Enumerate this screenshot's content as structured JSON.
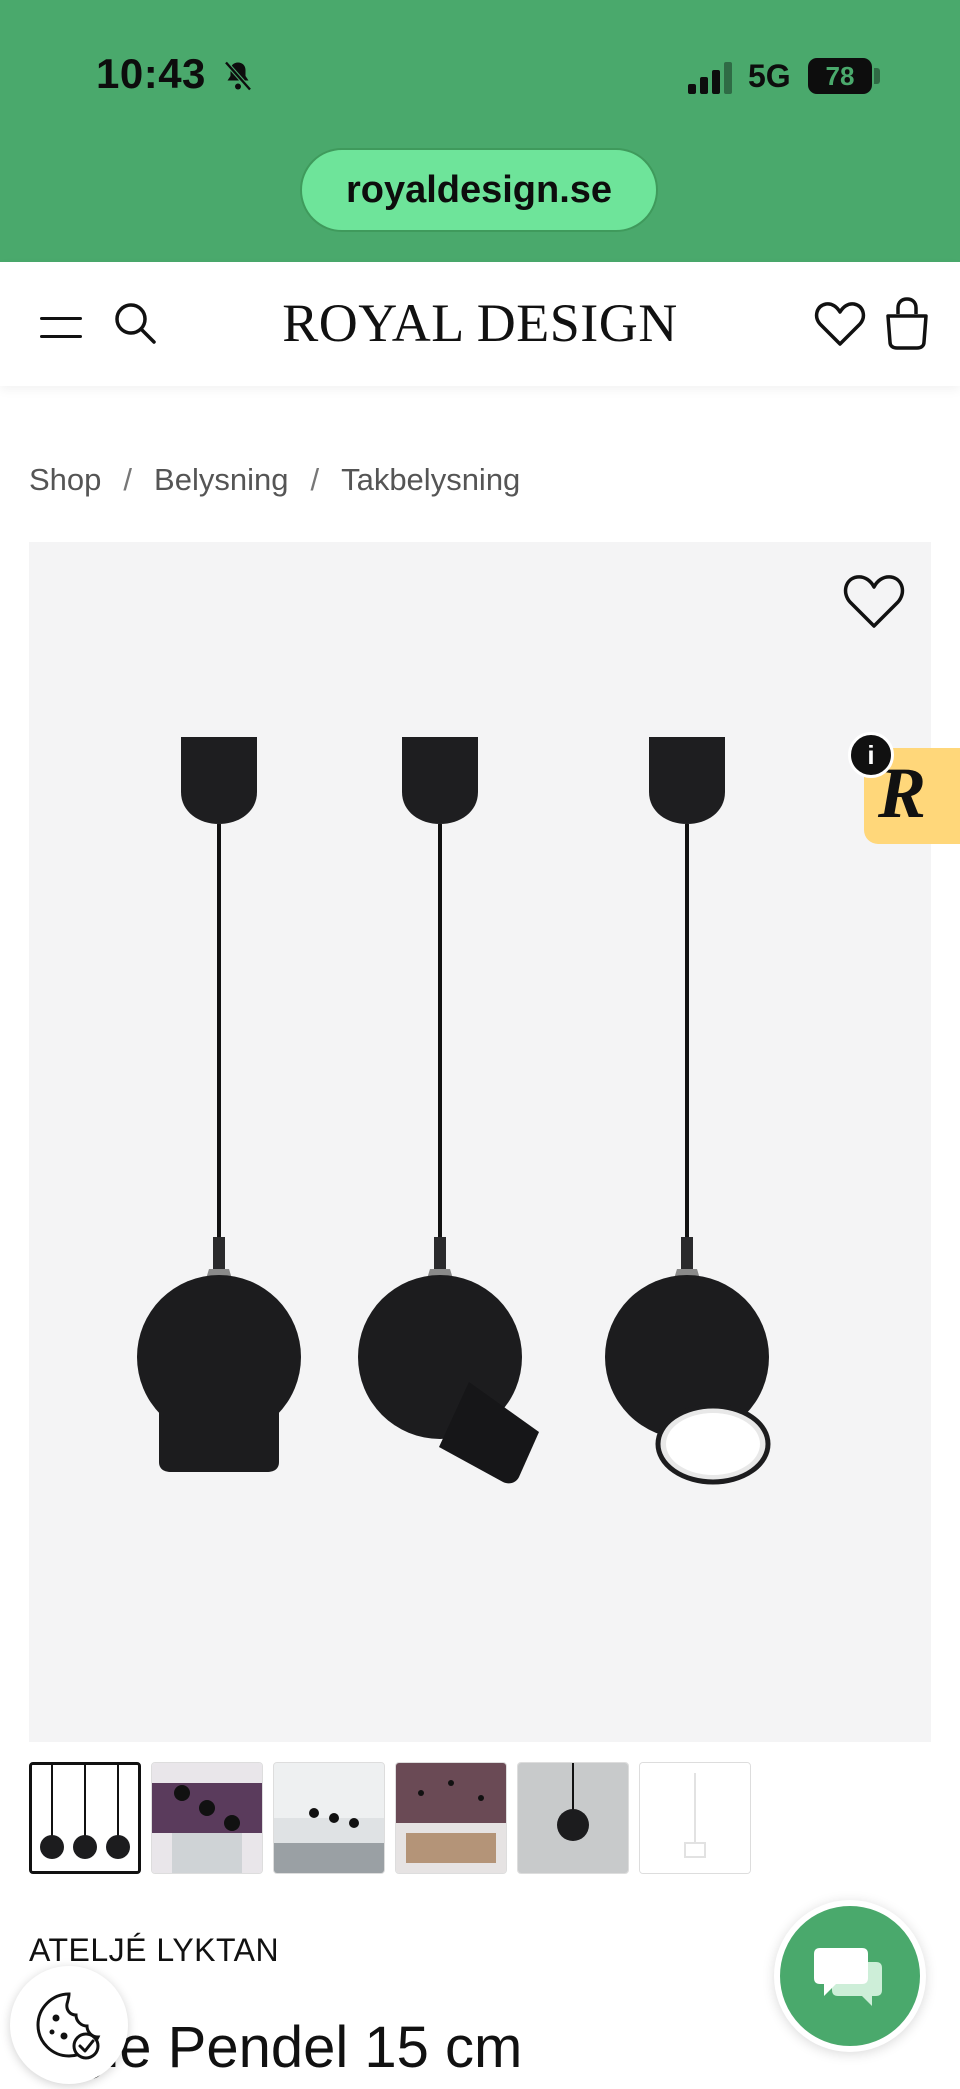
{
  "status_bar": {
    "time": "10:43",
    "network": "5G",
    "battery": "78"
  },
  "browser": {
    "url": "royaldesign.se"
  },
  "header": {
    "logo": "ROYAL DESIGN",
    "icons": [
      "menu-icon",
      "search-icon",
      "heart-icon",
      "bag-icon"
    ]
  },
  "breadcrumb": {
    "items": [
      "Shop",
      "Belysning",
      "Takbelysning"
    ],
    "separator": "/"
  },
  "product": {
    "brand": "ATELJÉ LYKTAN",
    "title": "Ogle Pendel 15 cm",
    "thumbnail_count": 6,
    "selected_thumbnail": 1
  },
  "floating": {
    "badge_letter": "R",
    "info_symbol": "i"
  },
  "colors": {
    "browser_green": "#4aa96c",
    "url_pill": "#6ee49a",
    "badge_yellow": "#ffd77a",
    "image_bg": "#f4f4f5"
  }
}
